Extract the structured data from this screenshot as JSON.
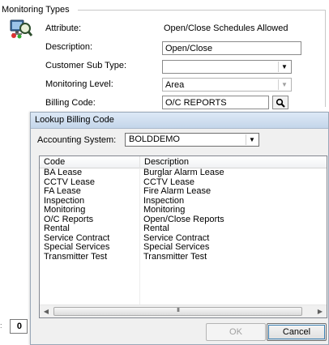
{
  "group": {
    "title": "Monitoring Types"
  },
  "icons": {
    "app": "monitoring-app-icon",
    "lookup": "magnifier-icon",
    "dropdown": "chevron-down-icon"
  },
  "form": {
    "attribute": {
      "label": "Attribute:",
      "value": "Open/Close Schedules Allowed"
    },
    "description": {
      "label": "Description:",
      "value": "Open/Close"
    },
    "customer_sub_type": {
      "label": "Customer Sub Type:",
      "value": ""
    },
    "monitoring_level": {
      "label": "Monitoring Level:",
      "value": "Area"
    },
    "billing_code": {
      "label": "Billing Code:",
      "value": "O/C REPORTS"
    }
  },
  "left_control": {
    "value": "0"
  },
  "dialog": {
    "title": "Lookup Billing Code",
    "accounting_system": {
      "label": "Accounting System:",
      "value": "BOLDDEMO"
    },
    "columns": [
      "Code",
      "Description"
    ],
    "rows": [
      {
        "code": "BA Lease",
        "description": "Burglar Alarm Lease"
      },
      {
        "code": "CCTV Lease",
        "description": "CCTV Lease"
      },
      {
        "code": "FA Lease",
        "description": "Fire Alarm Lease"
      },
      {
        "code": "Inspection",
        "description": "Inspection"
      },
      {
        "code": "Monitoring",
        "description": "Monitoring"
      },
      {
        "code": "O/C Reports",
        "description": "Open/Close Reports"
      },
      {
        "code": "Rental",
        "description": "Rental"
      },
      {
        "code": "Service Contract",
        "description": "Service Contract"
      },
      {
        "code": "Special Services",
        "description": "Special Services"
      },
      {
        "code": "Transmitter Test",
        "description": "Transmitter Test"
      }
    ],
    "scroll_grip": "III",
    "ok_label": "OK",
    "cancel_label": "Cancel"
  }
}
